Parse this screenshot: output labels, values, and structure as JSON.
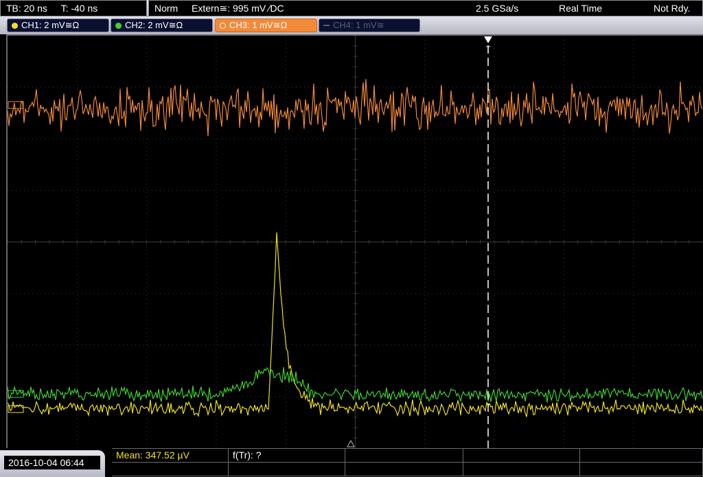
{
  "header": {
    "timebase": "TB: 20 ns",
    "trigger_time": "T: -40 ns",
    "acq_mode": "Norm",
    "trigger_source": "Extern≅: 995 mV ⁄DC",
    "sample_rate": "2.5 GSa/s",
    "acq_type": "Real Time",
    "status": "Not Rdy."
  },
  "channels": [
    {
      "label": "CH1: 2 mV≅Ω",
      "color": "#f0e020",
      "state": "on"
    },
    {
      "label": "CH2: 2 mV≅Ω",
      "color": "#40d030",
      "state": "on"
    },
    {
      "label": "CH3: 1 mV≅Ω",
      "color": "#f28a3a",
      "state": "selected"
    },
    {
      "label": "CH4: 1 mV≅",
      "color": "#595d70",
      "state": "off"
    }
  ],
  "trigger_marker": {
    "label": "T"
  },
  "footer": {
    "datetime": "2016-10-04 06:44",
    "measurements": [
      {
        "label": "Mean: 347.52 µV",
        "color": "#f0e020"
      },
      {
        "label": "f(Tr): ?",
        "color": "#ffffff"
      }
    ]
  },
  "colors": {
    "ch1": "#f0e020",
    "ch2": "#40d030",
    "ch3": "#f28a3a",
    "grid": "#3a3a3a",
    "trigger_line": "#ffffff"
  },
  "icons": [
    "channel-dot-icon",
    "trigger-position-icon",
    "ground-marker-icon"
  ]
}
